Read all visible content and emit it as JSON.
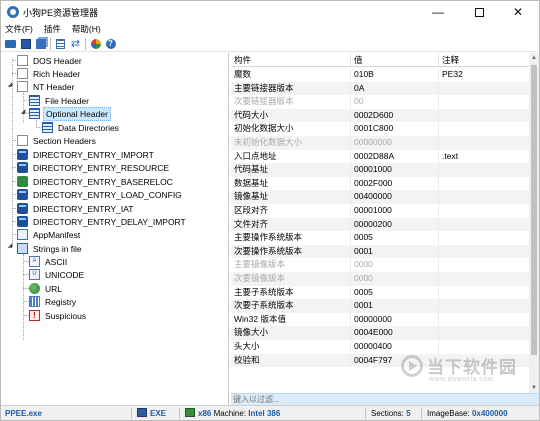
{
  "window": {
    "title": "小狗PE资源管理器",
    "icon": "app-icon",
    "controls": [
      "—",
      "☐",
      "✕"
    ]
  },
  "menu": [
    "文件(F)",
    "插件",
    "帮助(H)"
  ],
  "toolbar": {
    "icons": [
      "open-folder-icon",
      "save-icon",
      "save-all-icon",
      "grid-icon",
      "swap-icon",
      "globe-icon",
      "help-icon"
    ]
  },
  "tree": {
    "nodes": [
      {
        "label": "DOS Header",
        "icon": "page-icon"
      },
      {
        "label": "Rich Header",
        "icon": "page-icon"
      },
      {
        "label": "NT Header",
        "icon": "page-icon"
      },
      {
        "label": "File Header",
        "icon": "table-icon"
      },
      {
        "label": "Optional Header",
        "icon": "table-icon",
        "selected": true
      },
      {
        "label": "Data Directories",
        "icon": "table-icon"
      },
      {
        "label": "Section Headers",
        "icon": "page-icon"
      },
      {
        "label": "DIRECTORY_ENTRY_IMPORT",
        "icon": "directory-icon"
      },
      {
        "label": "DIRECTORY_ENTRY_RESOURCE",
        "icon": "directory-icon"
      },
      {
        "label": "DIRECTORY_ENTRY_BASERELOC",
        "icon": "directory-green-icon"
      },
      {
        "label": "DIRECTORY_ENTRY_LOAD_CONFIG",
        "icon": "directory-icon"
      },
      {
        "label": "DIRECTORY_ENTRY_IAT",
        "icon": "directory-icon"
      },
      {
        "label": "DIRECTORY_ENTRY_DELAY_IMPORT",
        "icon": "directory-icon"
      },
      {
        "label": "AppManifest",
        "icon": "manifest-icon"
      },
      {
        "label": "Strings in file",
        "icon": "strings-icon"
      },
      {
        "label": "ASCII",
        "icon": "ascii-icon"
      },
      {
        "label": "UNICODE",
        "icon": "unicode-icon"
      },
      {
        "label": "URL",
        "icon": "url-globe-icon"
      },
      {
        "label": "Registry",
        "icon": "registry-icon"
      },
      {
        "label": "Suspicious",
        "icon": "suspicious-icon"
      }
    ]
  },
  "grid": {
    "headers": [
      "构件",
      "值",
      "注释"
    ],
    "rows": [
      {
        "name": "魔数",
        "value": "010B",
        "note": "PE32",
        "dim": false
      },
      {
        "name": "主要链接器版本",
        "value": "0A",
        "note": "",
        "dim": false
      },
      {
        "name": "次要链接器版本",
        "value": "00",
        "note": "",
        "dim": true
      },
      {
        "name": "代码大小",
        "value": "0002D600",
        "note": "",
        "dim": false
      },
      {
        "name": "初始化数据大小",
        "value": "0001C800",
        "note": "",
        "dim": false
      },
      {
        "name": "未初始化数据大小",
        "value": "00000000",
        "note": "",
        "dim": true
      },
      {
        "name": "入口点地址",
        "value": "0002D88A",
        "note": ".text",
        "dim": false
      },
      {
        "name": "代码基址",
        "value": "00001000",
        "note": "",
        "dim": false
      },
      {
        "name": "数据基址",
        "value": "0002F000",
        "note": "",
        "dim": false
      },
      {
        "name": "镜像基址",
        "value": "00400000",
        "note": "",
        "dim": false
      },
      {
        "name": "区段对齐",
        "value": "00001000",
        "note": "",
        "dim": false
      },
      {
        "name": "文件对齐",
        "value": "00000200",
        "note": "",
        "dim": false
      },
      {
        "name": "主要操作系统版本",
        "value": "0005",
        "note": "",
        "dim": false
      },
      {
        "name": "次要操作系统版本",
        "value": "0001",
        "note": "",
        "dim": false
      },
      {
        "name": "主要镜像版本",
        "value": "0000",
        "note": "",
        "dim": true
      },
      {
        "name": "次要镜像版本",
        "value": "0000",
        "note": "",
        "dim": true
      },
      {
        "name": "主要子系统版本",
        "value": "0005",
        "note": "",
        "dim": false
      },
      {
        "name": "次要子系统版本",
        "value": "0001",
        "note": "",
        "dim": false
      },
      {
        "name": "Win32 版本值",
        "value": "00000000",
        "note": "",
        "dim": false
      },
      {
        "name": "镜像大小",
        "value": "0004E000",
        "note": "",
        "dim": false
      },
      {
        "name": "头大小",
        "value": "00000400",
        "note": "",
        "dim": false
      },
      {
        "name": "校验和",
        "value": "0004F797",
        "note": "",
        "dim": false
      }
    ]
  },
  "filter": {
    "placeholder": "键入以过滤..."
  },
  "status": {
    "file": "PPEE.exe",
    "type": "EXE",
    "arch": "x86",
    "machine_label": "Machine:",
    "machine_value": "Intel 386",
    "sections_label": "Sections:",
    "sections_value": "5",
    "imagebase_label": "ImageBase:",
    "imagebase_value": "0x400000"
  },
  "watermark": {
    "text": "当下软件园",
    "sub": "www.downxia.com"
  }
}
